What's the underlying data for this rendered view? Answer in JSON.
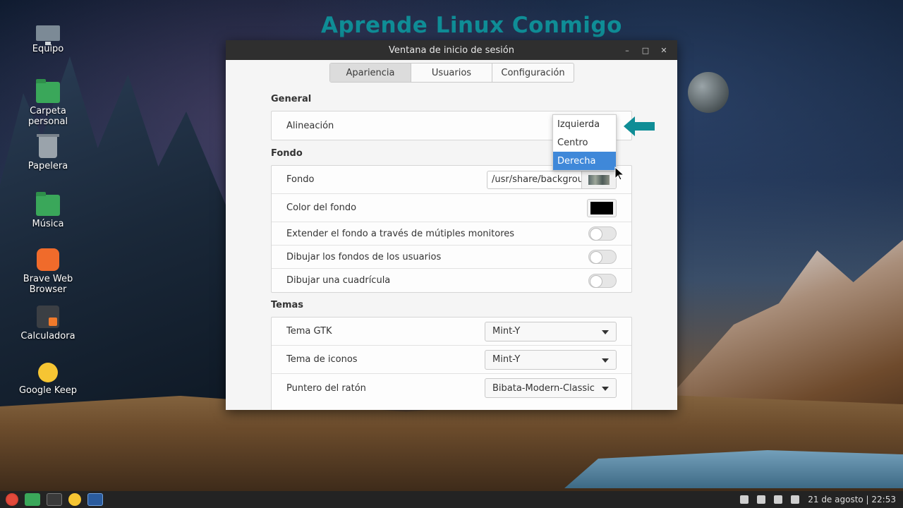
{
  "watermark": "Aprende Linux Conmigo",
  "desktop": {
    "icons": [
      {
        "label": "Equipo"
      },
      {
        "label": "Carpeta\npersonal"
      },
      {
        "label": "Papelera"
      },
      {
        "label": "Música"
      },
      {
        "label": "Brave Web\nBrowser"
      },
      {
        "label": "Calculadora"
      },
      {
        "label": "Google Keep"
      }
    ]
  },
  "window": {
    "title": "Ventana de inicio de sesión",
    "controls": {
      "minimize": "–",
      "maximize": "□",
      "close": "✕"
    },
    "tabs": [
      {
        "label": "Apariencia",
        "active": true
      },
      {
        "label": "Usuarios",
        "active": false
      },
      {
        "label": "Configuración",
        "active": false
      }
    ],
    "general": {
      "title": "General",
      "alignment_label": "Alineación"
    },
    "alignment_dropdown": {
      "options": [
        "Izquierda",
        "Centro",
        "Derecha"
      ],
      "selected": "Derecha"
    },
    "background": {
      "title": "Fondo",
      "bg_label": "Fondo",
      "bg_path": "/usr/share/backgrounds",
      "color_label": "Color del fondo",
      "color_value": "#000000",
      "stretch_label": "Extender el fondo a través de mútiples monitores",
      "stretch_on": false,
      "user_bg_label": "Dibujar los fondos de los usuarios",
      "user_bg_on": false,
      "grid_label": "Dibujar una cuadrícula",
      "grid_on": false
    },
    "themes": {
      "title": "Temas",
      "gtk_label": "Tema GTK",
      "gtk_value": "Mint-Y",
      "icons_label": "Tema de iconos",
      "icons_value": "Mint-Y",
      "cursor_label": "Puntero del ratón",
      "cursor_value": "Bibata-Modern-Classic"
    }
  },
  "taskbar": {
    "datetime": "21 de agosto | 22:53"
  },
  "colors": {
    "accent": "#3f88d9",
    "watermark": "#0f8d96",
    "arrow": "#0f8d96"
  }
}
